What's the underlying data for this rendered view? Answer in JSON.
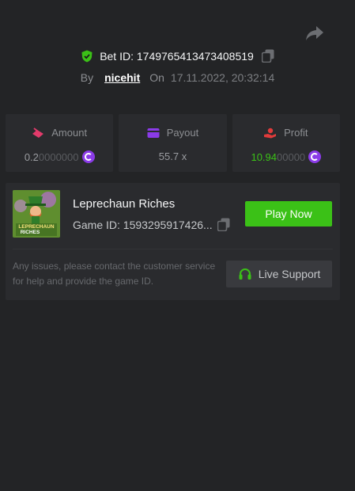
{
  "header": {
    "bet_id_label": "Bet ID: 1749765413473408519",
    "by_label": "By",
    "username": "nicehit",
    "on_label": "On",
    "date": "17.11.2022, 20:32:14"
  },
  "stats": {
    "amount": {
      "label": "Amount",
      "value_main": "0.2",
      "value_dim": "0000000",
      "icon": "coin-icon",
      "color": "#e23b6b"
    },
    "payout": {
      "label": "Payout",
      "value": "55.7 x",
      "color": "#8b3be8"
    },
    "profit": {
      "label": "Profit",
      "value_main": "10.94",
      "value_dim": "00000",
      "icon": "coin-icon",
      "color": "#e23b3b"
    }
  },
  "game": {
    "thumbnail_text": "LEPRECHAUN RICHES",
    "name": "Leprechaun Riches",
    "game_id_label": "Game ID: 1593295917426...",
    "play_label": "Play Now",
    "help_text": "Any issues, please contact the customer service for help and provide the game ID.",
    "support_label": "Live Support"
  },
  "colors": {
    "background": "#232426",
    "card": "#2a2b2e",
    "accent_green": "#3bc117",
    "coin_purple": "#8b3be8"
  }
}
